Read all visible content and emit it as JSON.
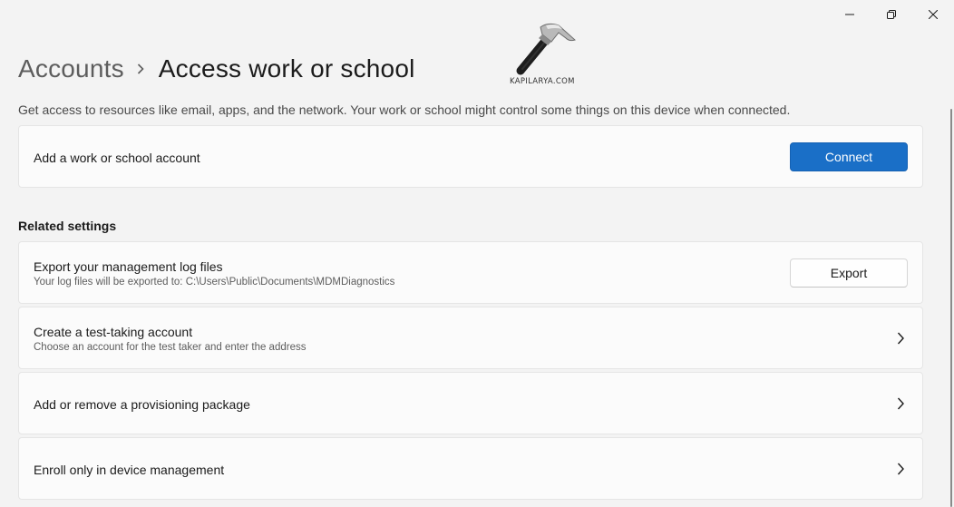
{
  "window": {
    "controls": {
      "minimize_icon": "minimize-icon",
      "maximize_icon": "restore-icon",
      "close_icon": "close-icon"
    }
  },
  "breadcrumb": {
    "parent": "Accounts",
    "current": "Access work or school"
  },
  "watermark": {
    "text": "KAPILARYA.COM"
  },
  "description": "Get access to resources like email, apps, and the network. Your work or school might control some things on this device when connected.",
  "add_account": {
    "title": "Add a work or school account",
    "button_label": "Connect"
  },
  "related": {
    "heading": "Related settings",
    "items": [
      {
        "title": "Export your management log files",
        "subtitle": "Your log files will be exported to: C:\\Users\\Public\\Documents\\MDMDiagnostics",
        "button_label": "Export"
      },
      {
        "title": "Create a test-taking account",
        "subtitle": "Choose an account for the test taker and enter the address"
      },
      {
        "title": "Add or remove a provisioning package"
      },
      {
        "title": "Enroll only in device management"
      }
    ]
  },
  "colors": {
    "accent": "#1a6fc7",
    "background": "#f3f3f3",
    "card": "#fbfbfb"
  }
}
